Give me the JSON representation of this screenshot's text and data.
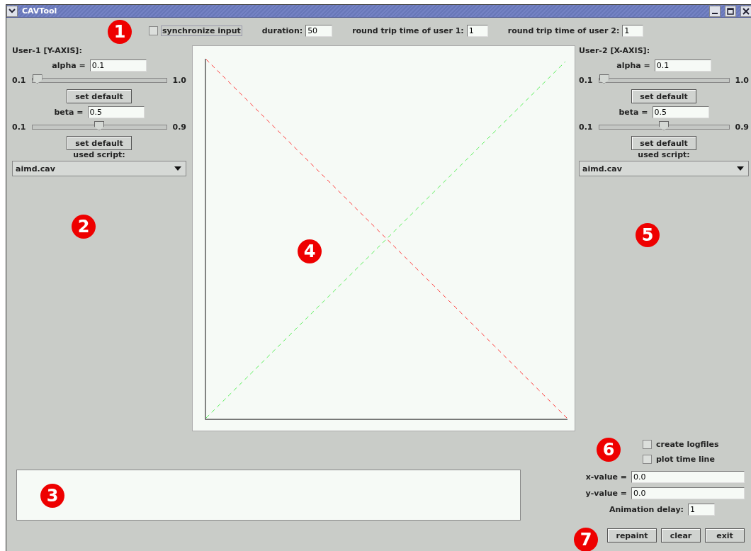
{
  "window": {
    "title": "CAVTool"
  },
  "top_bar": {
    "synchronize": {
      "label": "synchronize input",
      "checked": false
    },
    "duration": {
      "label": "duration:",
      "value": "50"
    },
    "rtt1": {
      "label": "round trip time of user 1:",
      "value": "1"
    },
    "rtt2": {
      "label": "round trip time of user 2:",
      "value": "1"
    }
  },
  "users": [
    {
      "title": "User-1 [Y-AXIS]:",
      "alpha": {
        "label": "alpha =",
        "value": "0.1",
        "min": "0.1",
        "max": "1.0",
        "level": 0.0,
        "button": "set default"
      },
      "beta": {
        "label": "beta =",
        "value": "0.5",
        "min": "0.1",
        "max": "0.9",
        "level": 0.5,
        "button": "set default"
      },
      "script_label": "used script:",
      "script": "aimd.cav"
    },
    {
      "title": "User-2 [X-AXIS]:",
      "alpha": {
        "label": "alpha =",
        "value": "0.1",
        "min": "0.1",
        "max": "1.0",
        "level": 0.0,
        "button": "set default"
      },
      "beta": {
        "label": "beta =",
        "value": "0.5",
        "min": "0.1",
        "max": "0.9",
        "level": 0.5,
        "button": "set default"
      },
      "script_label": "used script:",
      "script": "aimd.cav"
    }
  ],
  "options": [
    {
      "label": "create logfiles",
      "checked": false
    },
    {
      "label": "plot time line",
      "checked": false
    }
  ],
  "values": [
    {
      "label": "x-value =",
      "value": "0.0"
    },
    {
      "label": "y-value =",
      "value": "0.0"
    }
  ],
  "animation_delay": {
    "label": "Animation delay:",
    "value": "1"
  },
  "buttons": [
    "repaint",
    "clear",
    "exit"
  ],
  "markers": [
    "1",
    "2",
    "3",
    "4",
    "5",
    "6",
    "7"
  ]
}
